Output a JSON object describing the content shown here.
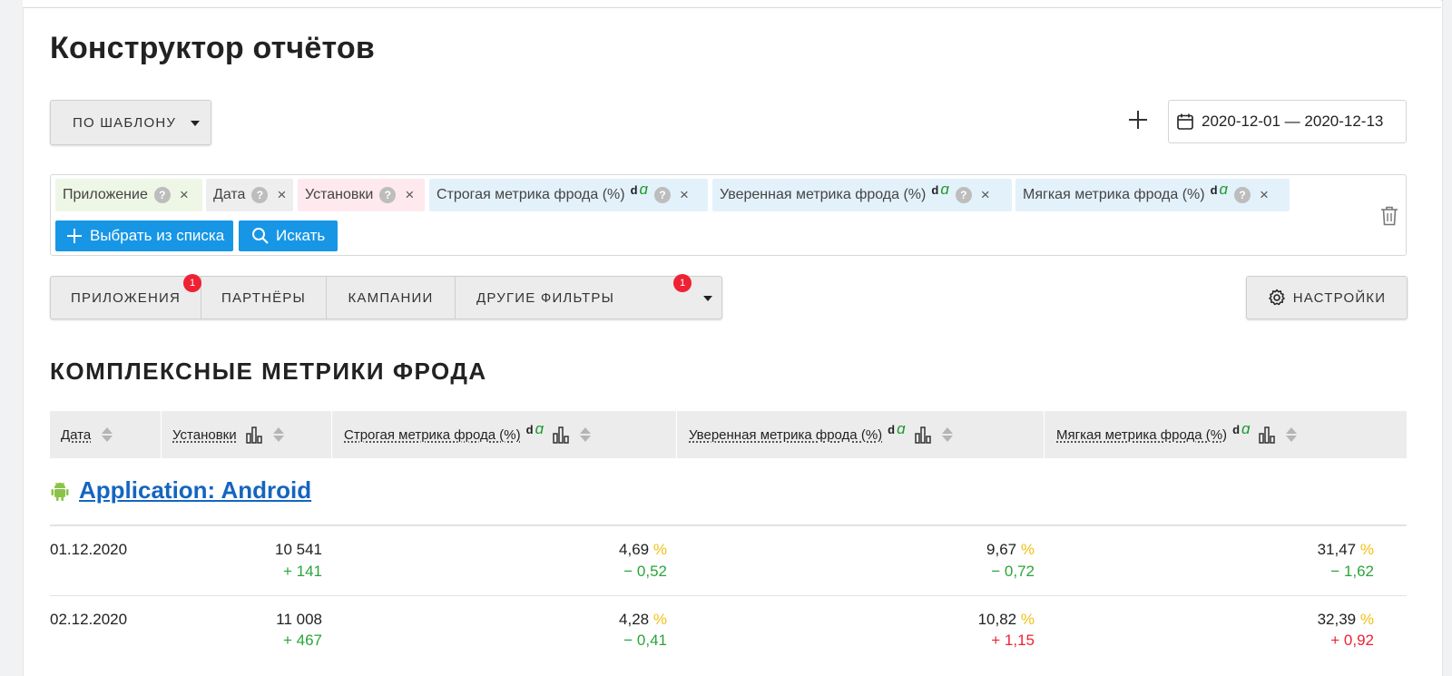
{
  "page_title": "Конструктор отчётов",
  "toolbar": {
    "template_label": "ПО ШАБЛОНУ",
    "date_range": "2020-12-01 — 2020-12-13"
  },
  "metrics": {
    "chips": [
      {
        "label": "Приложение",
        "q": "?",
        "x": "×",
        "alpha": false
      },
      {
        "label": "Дата",
        "q": "?",
        "x": "×",
        "alpha": false
      },
      {
        "label": "Установки",
        "q": "?",
        "x": "×",
        "alpha": false
      },
      {
        "label": "Строгая метрика фрода (%)",
        "q": "?",
        "x": "×",
        "alpha": true
      },
      {
        "label": "Уверенная метрика фрода (%)",
        "q": "?",
        "x": "×",
        "alpha": true
      },
      {
        "label": "Мягкая метрика фрода (%)",
        "q": "?",
        "x": "×",
        "alpha": true
      }
    ],
    "alpha_d": "d",
    "alpha_a": "ɑ",
    "select_from_list": "Выбрать из списка",
    "search": "Искать"
  },
  "filters": {
    "tabs": [
      {
        "label": "ПРИЛОЖЕНИЯ",
        "badge": "1"
      },
      {
        "label": "ПАРТНЁРЫ"
      },
      {
        "label": "КАМПАНИИ"
      },
      {
        "label": "ДРУГИЕ ФИЛЬТРЫ",
        "badge": "1"
      }
    ],
    "settings_label": "НАСТРОЙКИ"
  },
  "section_title": "КОМПЛЕКСНЫЕ МЕТРИКИ ФРОДА",
  "table": {
    "columns": [
      "Дата",
      "Установки",
      "Строгая метрика фрода (%)",
      "Уверенная метрика фрода (%)",
      "Мягкая метрика фрода (%)"
    ],
    "group": "Application: Android",
    "rows": [
      {
        "date": "01.12.2020",
        "installs": "10 541",
        "installs_delta": "+ 141",
        "strict": "4,69",
        "strict_delta": "− 0,52",
        "confident": "9,67",
        "confident_delta": "− 0,72",
        "soft": "31,47",
        "soft_delta": "− 1,62"
      },
      {
        "date": "02.12.2020",
        "installs": "11 008",
        "installs_delta": "+ 467",
        "strict": "4,28",
        "strict_delta": "− 0,41",
        "confident": "10,82",
        "confident_delta": "+ 1,15",
        "soft": "32,39",
        "soft_delta": "+ 0,92"
      }
    ],
    "percent_sign": "%"
  },
  "colors": {
    "accent_blue": "#1796e6",
    "link_blue": "#1565c0",
    "positive": "#2aa53a",
    "negative": "#ee2233",
    "percent": "#f1c012"
  }
}
